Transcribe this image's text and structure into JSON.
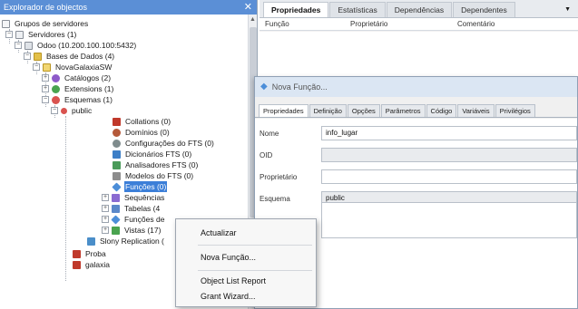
{
  "explorer": {
    "title": "Explorador de objectos",
    "tree": [
      {
        "label": "Grupos de servidores",
        "icon": "server-group-icon",
        "color": "#8a9099"
      },
      {
        "label": "Servidores (1)",
        "icon": "servers-icon",
        "color": "#8a9099"
      },
      {
        "label": "Odoo (10.200.100.100:5432)",
        "icon": "server-icon",
        "color": "#8a9099"
      },
      {
        "label": "Bases de Dados (4)",
        "icon": "databases-icon",
        "color": "#e3c04a"
      },
      {
        "label": "NovaGalaxiaSW",
        "icon": "database-icon",
        "color": "#e3c04a"
      },
      {
        "label": "Catálogos (2)",
        "icon": "catalogs-icon",
        "color": "#8e5bc9"
      },
      {
        "label": "Extensions (1)",
        "icon": "extensions-icon",
        "color": "#4aa34f"
      },
      {
        "label": "Esquemas (1)",
        "icon": "schemas-icon",
        "color": "#d9534f"
      },
      {
        "label": "public",
        "icon": "schema-icon",
        "color": "#d9534f"
      },
      {
        "label": "Collations (0)",
        "icon": "collations-icon",
        "color": "#c0392b"
      },
      {
        "label": "Domínios (0)",
        "icon": "domains-icon",
        "color": "#b55a3a"
      },
      {
        "label": "Configurações do FTS (0)",
        "icon": "fts-config-icon",
        "color": "#7f8c8d"
      },
      {
        "label": "Dicionários FTS (0)",
        "icon": "fts-dictionaries-icon",
        "color": "#3d7fc7"
      },
      {
        "label": "Analisadores FTS (0)",
        "icon": "fts-parsers-icon",
        "color": "#4a9b5a"
      },
      {
        "label": "Modelos do FTS (0)",
        "icon": "fts-templates-icon",
        "color": "#8d8d8d"
      },
      {
        "label": "Funções (0)",
        "icon": "functions-icon",
        "color": "#4c8ed8"
      },
      {
        "label": "Sequências",
        "icon": "sequences-icon",
        "color": "#8a6bd1"
      },
      {
        "label": "Tabelas (4",
        "icon": "tables-icon",
        "color": "#5b88c9"
      },
      {
        "label": "Funções de",
        "icon": "trigger-functions-icon",
        "color": "#4c8ed8"
      },
      {
        "label": "Vistas (17)",
        "icon": "views-icon",
        "color": "#4aa34f"
      },
      {
        "label": "Slony Replication (",
        "icon": "slony-icon",
        "color": "#4a8ec9"
      },
      {
        "label": "Proba",
        "icon": "database-icon",
        "color": "#c0392b"
      },
      {
        "label": "galaxia",
        "icon": "database-icon",
        "color": "#c0392b"
      }
    ]
  },
  "properties": {
    "tabs": [
      "Propriedades",
      "Estatísticas",
      "Dependências",
      "Dependentes"
    ],
    "more": "▼",
    "columns": [
      "Função",
      "Proprietário",
      "Comentário"
    ]
  },
  "dialog": {
    "title": "Nova Função...",
    "tabs": [
      "Propriedades",
      "Definição",
      "Opções",
      "Parâmetros",
      "Código",
      "Variáveis",
      "Privilégios"
    ],
    "fields": [
      {
        "label": "Nome",
        "value": "info_lugar"
      },
      {
        "label": "OID",
        "value": ""
      },
      {
        "label": "Proprietário",
        "value": ""
      },
      {
        "label": "Esquema",
        "value": "public"
      }
    ]
  },
  "context_menu": {
    "items": [
      "Actualizar",
      "Nova Função...",
      "Object List Report",
      "Grant Wizard..."
    ]
  },
  "colors": {
    "accent": "#3c7fd8",
    "title_bar": "#5b8fd6"
  }
}
